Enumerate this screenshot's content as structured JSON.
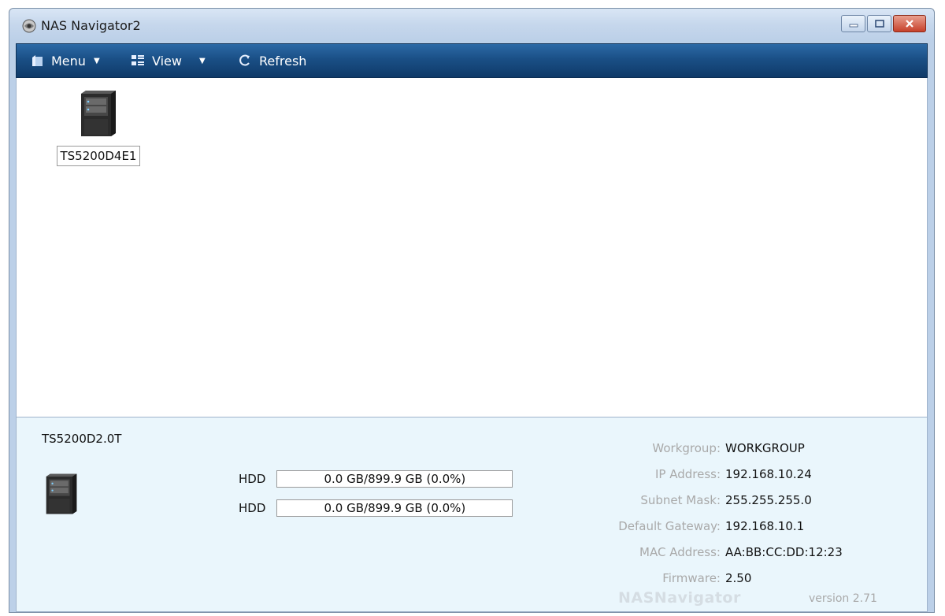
{
  "window": {
    "title": "NAS Navigator2"
  },
  "toolbar": {
    "menu_label": "Menu",
    "view_label": "View",
    "refresh_label": "Refresh"
  },
  "devices": [
    {
      "name": "TS5200D4E1"
    }
  ],
  "details": {
    "device_name": "TS5200D2.0T",
    "hdds": [
      {
        "label": "HDD",
        "usage": "0.0 GB/899.9 GB (0.0%)",
        "used_fraction": 0.0
      },
      {
        "label": "HDD",
        "usage": "0.0 GB/899.9 GB (0.0%)",
        "used_fraction": 0.0
      }
    ],
    "info": [
      {
        "label": "Workgroup:",
        "value": "WORKGROUP"
      },
      {
        "label": "IP Address:",
        "value": "192.168.10.24"
      },
      {
        "label": "Subnet Mask:",
        "value": "255.255.255.0"
      },
      {
        "label": "Default Gateway:",
        "value": "192.168.10.1"
      },
      {
        "label": "MAC Address:",
        "value": "AA:BB:CC:DD:12:23"
      },
      {
        "label": "Firmware:",
        "value": "2.50"
      }
    ],
    "brand": "NASNavigator",
    "version": "version 2.71"
  },
  "colors": {
    "toolbar": "#1a4f86",
    "details_bg": "#eaf6fc",
    "label_gray": "#a9a9a9"
  }
}
